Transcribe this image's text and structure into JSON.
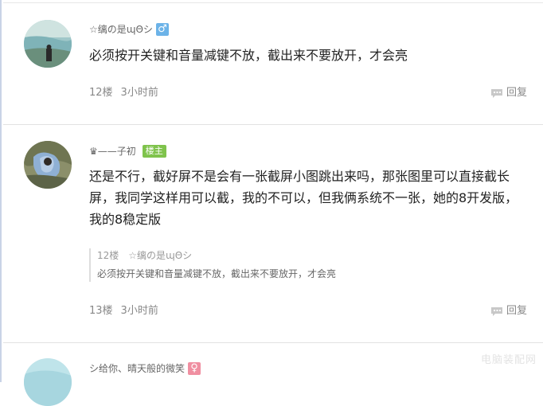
{
  "posts": [
    {
      "username": "☆缡の是ɰΘシ",
      "gender": "male",
      "gender_symbol": "♂",
      "content": "必须按开关键和音量减键不放，截出来不要放开，才会亮",
      "floor": "12楼",
      "time": "3小时前",
      "reply_label": "回复"
    },
    {
      "username": "♛——子初",
      "badge": "楼主",
      "content": "还是不行，截好屏不是会有一张截屏小图跳出来吗，那张图里可以直接截长屏，我同学这样用可以截，我的不可以，但我俩系统不一张，她的8开发版，我的8稳定版",
      "quote": {
        "floor": "12楼",
        "username": "☆缡の是ɰΘシ",
        "text": "必须按开关键和音量减键不放，截出来不要放开，才会亮"
      },
      "floor": "13楼",
      "time": "3小时前",
      "reply_label": "回复"
    },
    {
      "username": "シ给你、晴天般的微笑",
      "gender": "female",
      "gender_symbol": "♀"
    }
  ],
  "watermark": "电脑装配网"
}
